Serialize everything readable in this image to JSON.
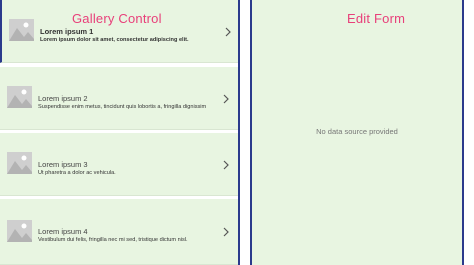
{
  "gallery": {
    "overlay_title": "Gallery Control",
    "items": [
      {
        "title": "Lorem ipsum 1",
        "subtitle": "Lorem ipsum dolor sit amet, consectetur adipiscing elit."
      },
      {
        "title": "Lorem ipsum 2",
        "subtitle": "Suspendisse enim metus, tincidunt quis lobortis a, fringilla dignissim"
      },
      {
        "title": "Lorem ipsum 3",
        "subtitle": "Ut pharetra a dolor ac vehicula."
      },
      {
        "title": "Lorem ipsum 4",
        "subtitle": "Vestibulum dui felis, fringilla nec mi sed, tristique dictum nisl."
      }
    ]
  },
  "edit_form": {
    "overlay_title": "Edit Form",
    "empty_message": "No data source provided"
  },
  "icons": {
    "thumbnail": "image-placeholder-icon",
    "next": "chevron-right-icon"
  },
  "colors": {
    "panel_bg": "#e8f5e1",
    "divider": "#2b3a8c",
    "overlay_text": "#e8407a"
  }
}
